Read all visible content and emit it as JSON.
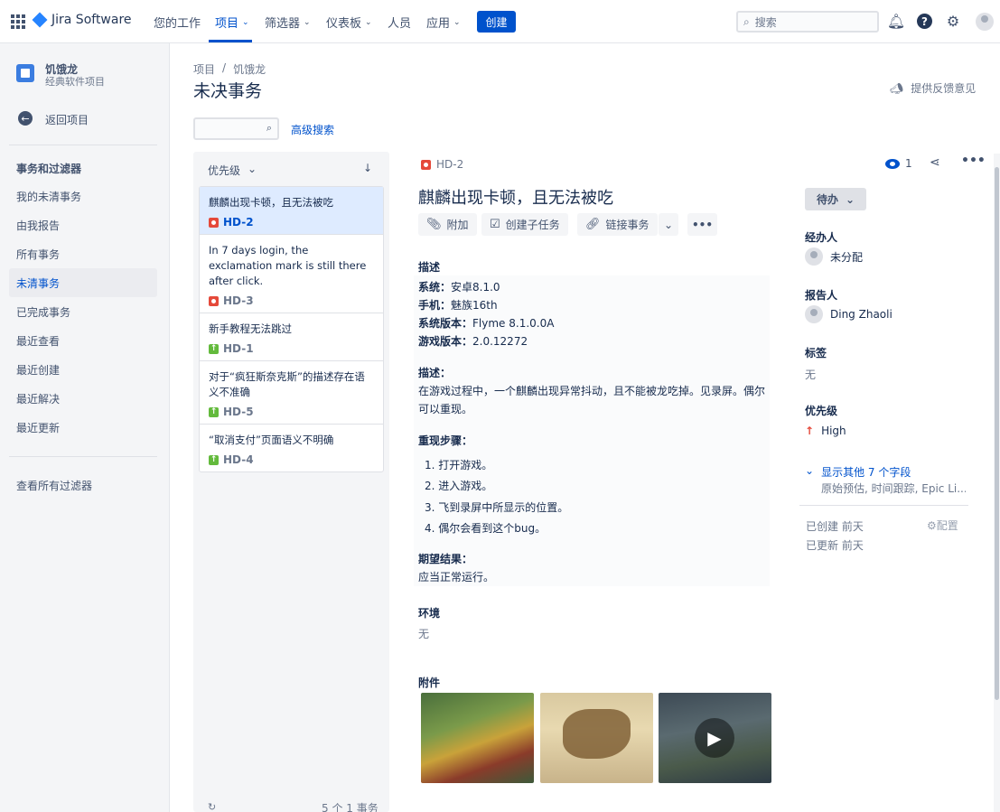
{
  "topnav": {
    "logo": "Jira Software",
    "items": [
      {
        "label": "您的工作",
        "caret": false
      },
      {
        "label": "项目",
        "caret": true
      },
      {
        "label": "筛选器",
        "caret": true
      },
      {
        "label": "仪表板",
        "caret": true
      },
      {
        "label": "人员",
        "caret": false
      },
      {
        "label": "应用",
        "caret": true
      }
    ],
    "create_label": "创建",
    "search_placeholder": "搜索",
    "accent": "#0052cc"
  },
  "sidebar": {
    "project_name": "饥饿龙",
    "project_type": "经典软件项目",
    "back_label": "返回项目",
    "heading": "事务和过滤器",
    "items": [
      "我的未清事务",
      "由我报告",
      "所有事务",
      "未清事务",
      "已完成事务",
      "最近查看",
      "最近创建",
      "最近解决",
      "最近更新"
    ],
    "active_item": "未清事务",
    "view_all": "查看所有过滤器"
  },
  "header": {
    "breadcrumb": [
      "项目",
      "/",
      "饥饿龙"
    ],
    "title": "未决事务",
    "feedback": "提供反馈意见",
    "advanced_search": "高级搜索"
  },
  "list": {
    "sort_label": "优先级",
    "cards": [
      {
        "summary": "麒麟出现卡顿，且无法被吃",
        "key": "HD-2",
        "type": "bug"
      },
      {
        "summary": "In 7 days login, the exclamation mark is still there after click.",
        "key": "HD-3",
        "type": "bug"
      },
      {
        "summary": "新手教程无法跳过",
        "key": "HD-1",
        "type": "improvement"
      },
      {
        "summary": "对于“疯狂斯奈克斯”的描述存在语义不准确",
        "key": "HD-5",
        "type": "improvement"
      },
      {
        "summary": "“取消支付”页面语义不明确",
        "key": "HD-4",
        "type": "improvement"
      }
    ],
    "footer": "5 个 1 事务"
  },
  "issue": {
    "key": "HD-2",
    "title": "麒麟出现卡顿，且无法被吃",
    "actions": {
      "attach": "附加",
      "subtask": "创建子任务",
      "link": "链接事务"
    },
    "watch_count": "1",
    "description_label": "描述",
    "specs": [
      {
        "k": "系统：",
        "v": "安卓8.1.0"
      },
      {
        "k": "手机：",
        "v": "魅族16th"
      },
      {
        "k": "系统版本：",
        "v": "Flyme 8.1.0.0A"
      },
      {
        "k": "游戏版本：",
        "v": "2.0.12272"
      }
    ],
    "desc_heading": "描述：",
    "desc_text_1": "在游戏过程中，一个麒麟出现异常抖动，且不能被龙吃掉。见录屏。偶尔",
    "desc_text_2": "可以重现。",
    "steps_heading": "重现步骤：",
    "steps": [
      "1. 打开游戏。",
      "2. 进入游戏。",
      "3. 飞到录屏中所显示的位置。",
      "4. 偶尔会看到这个bug。"
    ],
    "expected_heading": "期望结果：",
    "expected_text": "应当正常运行。",
    "environment_label": "环境",
    "environment_value": "无",
    "attachments_label": "附件"
  },
  "fields": {
    "status": "待办",
    "assignee_label": "经办人",
    "assignee": "未分配",
    "reporter_label": "报告人",
    "reporter": "Ding Zhaoli",
    "labels_label": "标签",
    "labels": "无",
    "priority_label": "优先级",
    "priority": "High",
    "more_fields": "显示其他 7 个字段",
    "more_sub": "原始预估, 时间跟踪, Epic Li...",
    "created": "已创建 前天",
    "updated": "已更新 前天",
    "configure": "配置"
  }
}
